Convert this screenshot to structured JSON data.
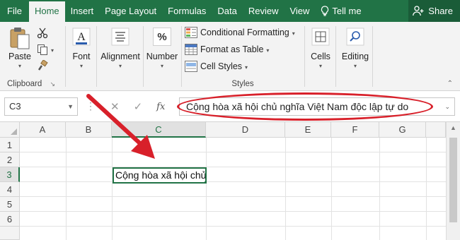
{
  "tabs": {
    "file": "File",
    "home": "Home",
    "insert": "Insert",
    "page_layout": "Page Layout",
    "formulas": "Formulas",
    "data": "Data",
    "review": "Review",
    "view": "View",
    "tell_me": "Tell me",
    "share": "Share"
  },
  "ribbon": {
    "clipboard": {
      "paste": "Paste",
      "group": "Clipboard"
    },
    "font": {
      "label": "Font"
    },
    "alignment": {
      "label": "Alignment"
    },
    "number": {
      "label": "Number",
      "icon_text": "%"
    },
    "styles": {
      "conditional_formatting": "Conditional Formatting",
      "format_as_table": "Format as Table",
      "cell_styles": "Cell Styles",
      "group": "Styles"
    },
    "cells": {
      "label": "Cells"
    },
    "editing": {
      "label": "Editing"
    }
  },
  "formula_bar": {
    "name_box": "C3",
    "fx": "fx",
    "content": "Cộng hòa xã hội chủ nghĩa Việt Nam độc lập tự do"
  },
  "grid": {
    "columns": [
      "A",
      "B",
      "C",
      "D",
      "E",
      "F",
      "G"
    ],
    "rows": [
      "1",
      "2",
      "3",
      "4",
      "5",
      "6"
    ],
    "active_cell_text": "Cộng hòa xã hội chủ"
  },
  "colors": {
    "accent": "#217346",
    "annotation_red": "#d8202a"
  }
}
